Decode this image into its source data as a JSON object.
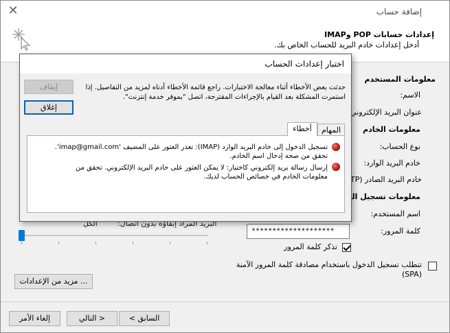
{
  "window": {
    "title": "إضافة حساب"
  },
  "header": {
    "title": "إعدادات حسابات POP وIMAP",
    "subtitle": "أدخل إعدادات خادم البريد للحساب الخاص بك."
  },
  "user_section": {
    "heading": "معلومات المستخدم",
    "name_label": "الاسم:",
    "email_label": "عنوان البريد الإلكتروني:"
  },
  "server_section": {
    "heading": "معلومات الخادم",
    "account_type_label": "نوع الحساب:",
    "incoming_label": "خادم البريد الوارد:",
    "outgoing_label": "خادم البريد الصادر (SMTP):"
  },
  "login_section": {
    "heading": "معلومات تسجيل الدخول",
    "username_label": "اسم المستخدم:",
    "password_label": "كلمة المرور:",
    "password_value": "********************",
    "remember_label": "تذكر كلمة المرور",
    "remember_checked": true,
    "spa_label": "تتطلب تسجيل الدخول باستخدام مصادقة كلمة المرور الآمنة (SPA)",
    "spa_checked": false
  },
  "offline": {
    "label": "البريد المراد إبقاؤه بدون اتصال:",
    "value": "الكل"
  },
  "buttons": {
    "more_settings": "مزيد من الإعدادات ...",
    "back": "< السابق",
    "next": "التالي >",
    "cancel": "إلغاء الأمر"
  },
  "dialog": {
    "title": "اختبار إعدادات الحساب",
    "message": "حدثت بعض الأخطاء أثناء معالجة الاختبارات. راجع قائمة الأخطاء أدناه لمزيد من التفاصيل. إذا استمرت المشكلة بعد القيام بالإجراءات المقترحة، اتصل \"بموفر خدمة إنترنت\".",
    "stop_label": "إيقاف",
    "close_label": "إغلاق",
    "tabs": [
      {
        "label": "المهام"
      },
      {
        "label": "أخطاء"
      }
    ],
    "errors": [
      {
        "text": "تسجيل الدخول إلى خادم البريد الوارد (IMAP): تعذر العثور على المضيف 'imap@gmail.com'. تحقق من صحة إدخال اسم الخادم."
      },
      {
        "text": "إرسال رسالة بريد إلكتروني كاختبار: لا يمكن العثور على خادم البريد الإلكتروني. تحقق من معلومات الخادم في خصائص الحساب لديك."
      }
    ]
  },
  "colors": {
    "accent": "#0078d7",
    "error_icon": "#b01810",
    "dialog_border": "#5a5a5a"
  },
  "icons": {
    "close": "close-icon",
    "wizard": "sparkle-cursor-icon",
    "error": "error-icon"
  }
}
